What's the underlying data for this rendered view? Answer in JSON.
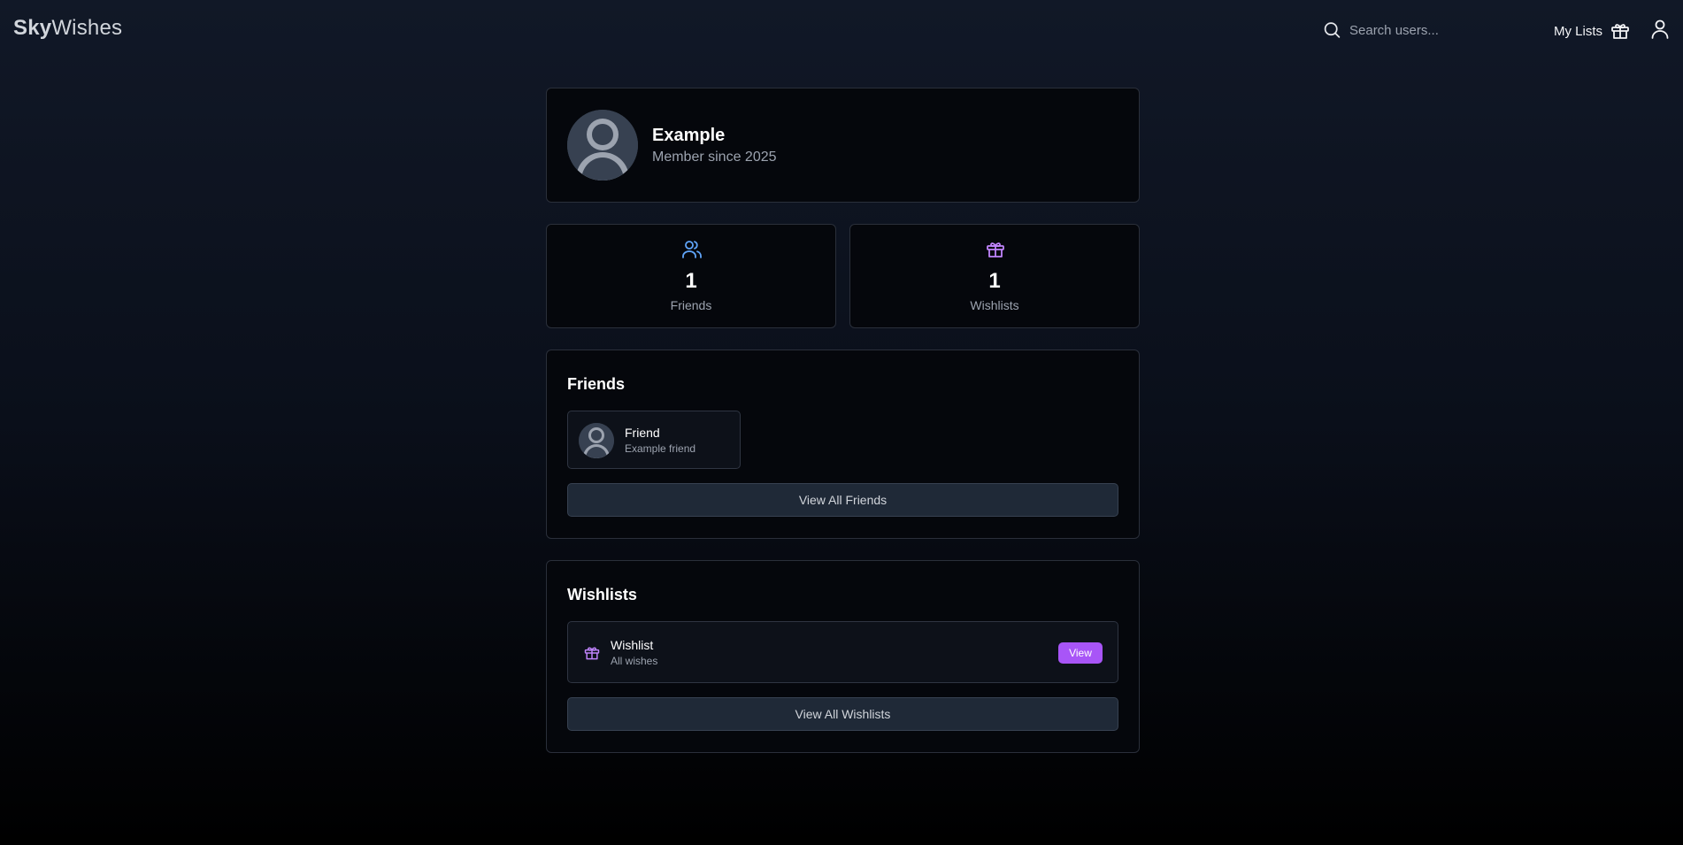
{
  "header": {
    "logo_bold": "Sky",
    "logo_rest": "Wishes",
    "search_placeholder": "Search users...",
    "my_lists_label": "My Lists"
  },
  "profile": {
    "name": "Example",
    "member_since": "Member since 2025"
  },
  "stats": {
    "friends": {
      "value": "1",
      "label": "Friends",
      "icon": "users-icon",
      "color": "#60a5fa"
    },
    "wishlists": {
      "value": "1",
      "label": "Wishlists",
      "icon": "gift-icon",
      "color": "#c084fc"
    }
  },
  "friends_section": {
    "title": "Friends",
    "items": [
      {
        "name": "Friend",
        "subtitle": "Example friend"
      }
    ],
    "view_all_label": "View All Friends"
  },
  "wishlists_section": {
    "title": "Wishlists",
    "items": [
      {
        "name": "Wishlist",
        "subtitle": "All wishes",
        "action_label": "View"
      }
    ],
    "view_all_label": "View All Wishlists"
  },
  "colors": {
    "accent_purple": "#a855f7",
    "accent_blue": "#60a5fa"
  }
}
